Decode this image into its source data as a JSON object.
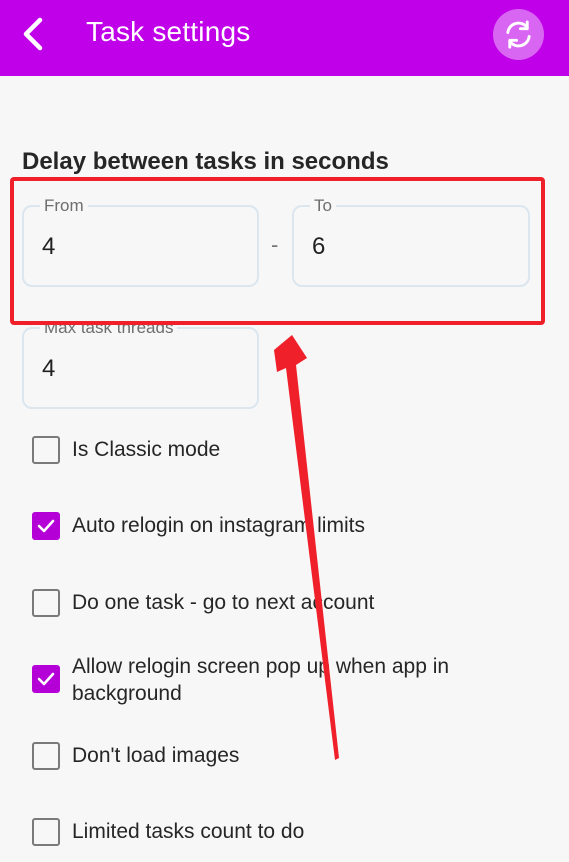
{
  "header": {
    "title": "Task settings",
    "back_icon": "chevron-left-icon",
    "refresh_icon": "refresh-icon",
    "bg_color": "#c000e8"
  },
  "delay": {
    "section_title": "Delay between tasks in seconds",
    "from_label": "From",
    "from_value": "4",
    "separator": "-",
    "to_label": "To",
    "to_value": "6"
  },
  "threads": {
    "label": "Max task threads",
    "value": "4"
  },
  "options": [
    {
      "label": "Is Classic mode",
      "checked": false
    },
    {
      "label": "Auto relogin on instagram limits",
      "checked": true
    },
    {
      "label": "Do one task - go to next account",
      "checked": false
    },
    {
      "label": "Allow relogin screen pop up when app in background",
      "checked": true
    },
    {
      "label": "Don't load images",
      "checked": false
    },
    {
      "label": "Limited tasks count to do",
      "checked": false
    }
  ],
  "colors": {
    "accent": "#b400d6",
    "annotation": "#f0202a"
  }
}
